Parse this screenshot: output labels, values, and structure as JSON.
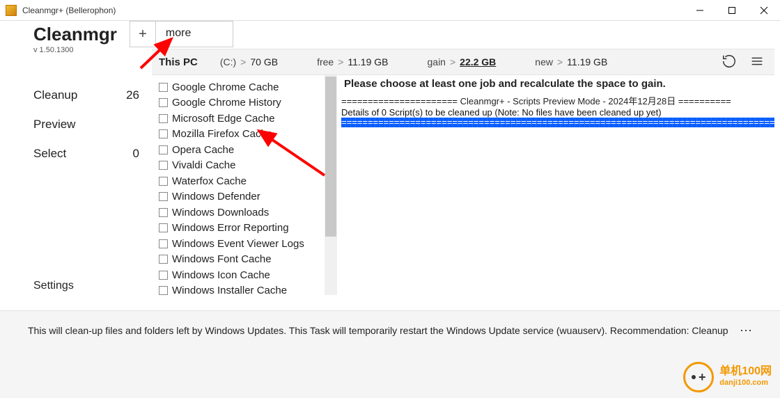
{
  "window": {
    "title": "Cleanmgr+ (Bellerophon)"
  },
  "header": {
    "app_name": "Cleanmgr",
    "plus": "+",
    "more_tab": "more",
    "version": "v 1.50.1300"
  },
  "stats": {
    "label": "This PC",
    "drive_key": "(C:)",
    "drive_val": "70 GB",
    "free_key": "free",
    "free_val": "11.19 GB",
    "gain_key": "gain",
    "gain_val": "22.2 GB",
    "new_key": "new",
    "new_val": "11.19 GB"
  },
  "nav": {
    "cleanup": {
      "label": "Cleanup",
      "count": "26"
    },
    "preview": {
      "label": "Preview",
      "count": ""
    },
    "select": {
      "label": "Select",
      "count": "0"
    },
    "settings": {
      "label": "Settings"
    }
  },
  "jobs": [
    "Google Chrome Cache",
    "Google Chrome History",
    "Microsoft Edge Cache",
    "Mozilla Firefox Cache",
    "Opera Cache",
    "Vivaldi Cache",
    "Waterfox Cache",
    "Windows Defender",
    "Windows Downloads",
    "Windows Error Reporting",
    "Windows Event Viewer Logs",
    "Windows Font Cache",
    "Windows Icon Cache",
    "Windows Installer Cache"
  ],
  "preview": {
    "instruction": "Please choose at least one job and recalculate the space to gain.",
    "banner_left_eq": "======================",
    "banner_mid": " Cleanmgr+ - Scripts Preview Mode - 2024年12月28日 ",
    "banner_right_eq": "==========",
    "details": "Details of 0 Script(s) to be cleaned up (Note: No files have been cleaned up yet)",
    "blue_eq": "===================================================================================================="
  },
  "bottom": {
    "text": "This will clean-up files and folders left by Windows Updates. This Task will temporarily restart the Windows Update service (wuauserv). Recommendation: Cleanup"
  },
  "watermark": {
    "line1": "单机100网",
    "line2": "danji100.com"
  }
}
